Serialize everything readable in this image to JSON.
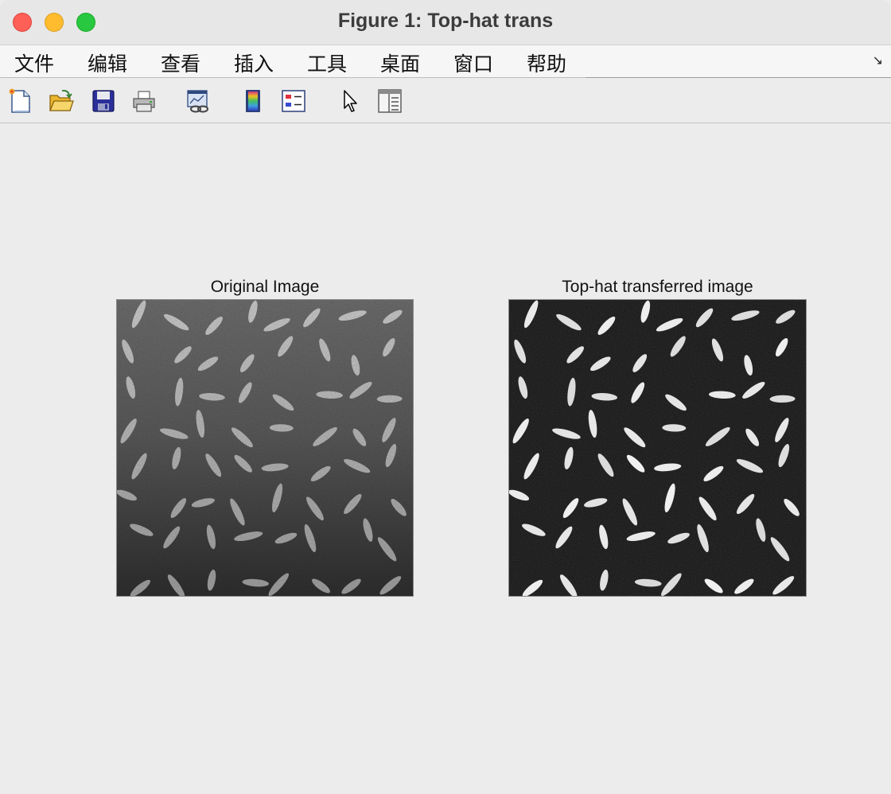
{
  "window": {
    "title": "Figure 1: Top-hat trans"
  },
  "menu": {
    "items": [
      {
        "label": "文件"
      },
      {
        "label": "编辑"
      },
      {
        "label": "查看"
      },
      {
        "label": "插入"
      },
      {
        "label": "工具"
      },
      {
        "label": "桌面"
      },
      {
        "label": "窗口"
      },
      {
        "label": "帮助"
      }
    ],
    "corner_arrow": "↘"
  },
  "toolbar": {
    "buttons": [
      {
        "icon": "new-figure-icon"
      },
      {
        "icon": "open-folder-icon"
      },
      {
        "icon": "save-icon"
      },
      {
        "icon": "print-icon"
      },
      {
        "icon": "link-plot-icon"
      },
      {
        "icon": "colorbar-icon"
      },
      {
        "icon": "legend-icon"
      },
      {
        "icon": "pointer-arrow-icon"
      },
      {
        "icon": "property-editor-icon"
      }
    ]
  },
  "figure": {
    "left_axes": {
      "title": "Original Image"
    },
    "right_axes": {
      "title": "Top-hat transferred image"
    }
  }
}
